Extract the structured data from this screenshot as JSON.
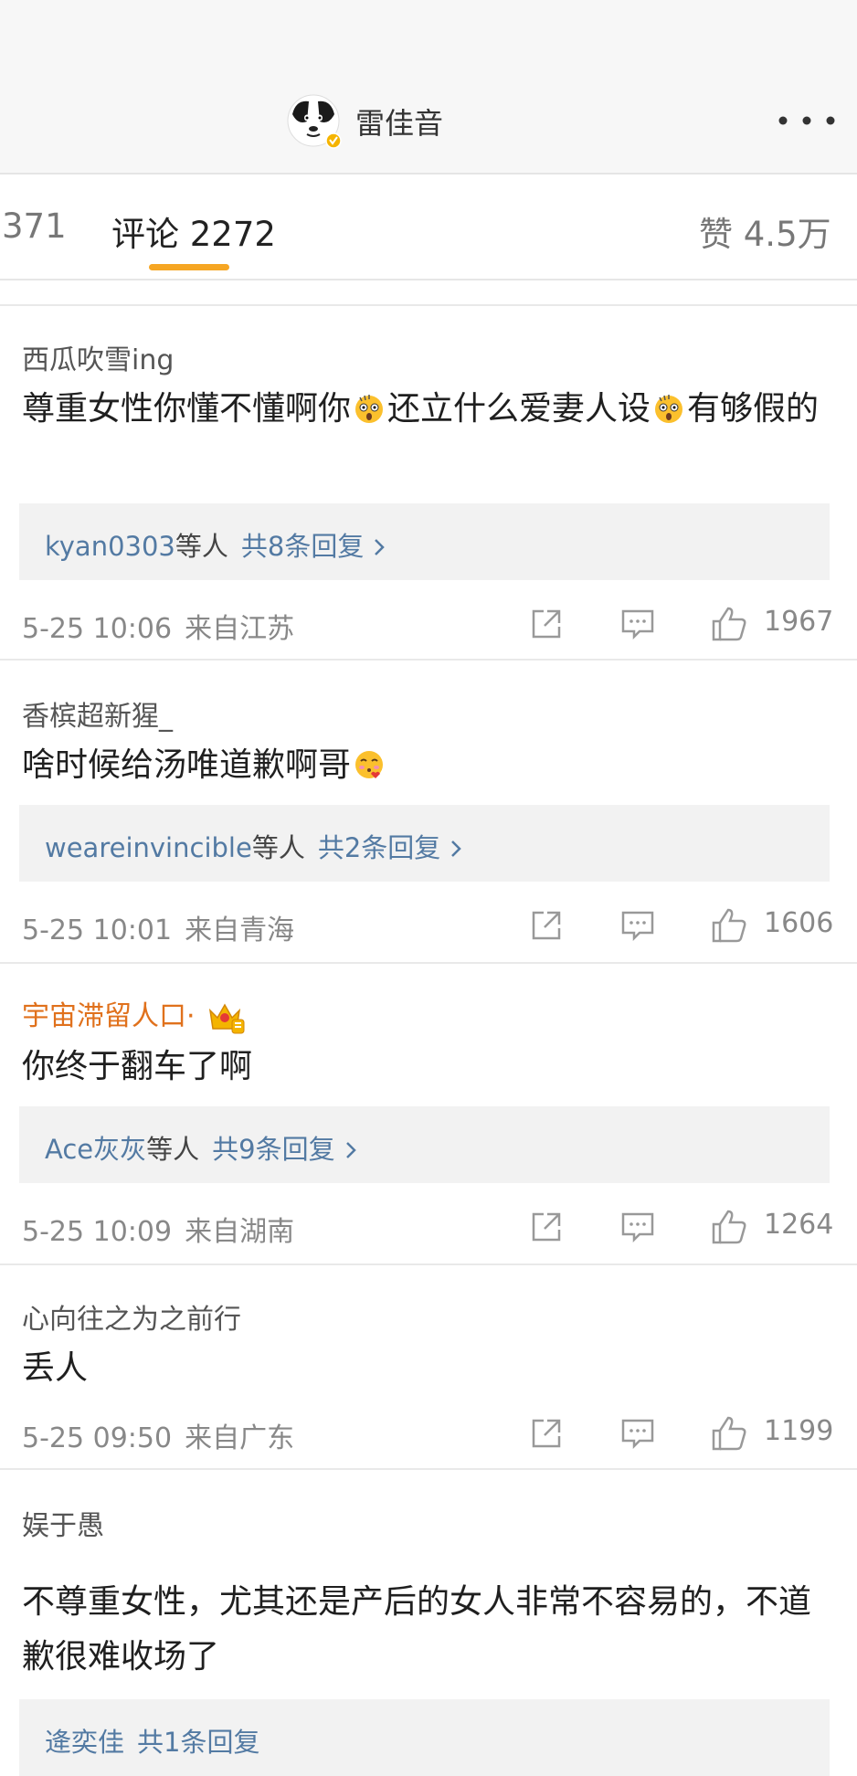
{
  "header": {
    "title": "雷佳音",
    "avatar_icon": "dog-avatar-icon",
    "verified_badge_icon": "verified-badge-icon",
    "more_icon": "more-dots-icon"
  },
  "tabs": {
    "reposts_partial": "371",
    "comments_label": "评论",
    "comments_count": "2272",
    "likes_label": "赞",
    "likes_count": "4.5万",
    "active_color": "#f6a623"
  },
  "comments": [
    {
      "user": "西瓜吹雪ing",
      "text_parts": [
        "尊重女性你懂不懂啊你",
        "还立什么爱妻人设",
        "有够假的"
      ],
      "reply_users": "kyan0303",
      "reply_suffix": "等人",
      "reply_total": "共8条回复",
      "time": "5-25 10:06",
      "location": "来自江苏",
      "likes": "1967"
    },
    {
      "user": "香槟超新猩_",
      "text_parts": [
        "啥时候给汤唯道歉啊哥"
      ],
      "reply_users": "weareinvincible",
      "reply_suffix": "等人",
      "reply_total": "共2条回复",
      "time": "5-25 10:01",
      "location": "来自青海",
      "likes": "1606"
    },
    {
      "user": "宇宙滞留人口·",
      "text_parts": [
        "你终于翻车了啊"
      ],
      "reply_users": "Ace灰灰",
      "reply_suffix": "等人",
      "reply_total": "共9条回复",
      "time": "5-25 10:09",
      "location": "来自湖南",
      "likes": "1264"
    },
    {
      "user": "心向往之为之前行",
      "text_parts": [
        "丢人"
      ],
      "time": "5-25 09:50",
      "location": "来自广东",
      "likes": "1199"
    },
    {
      "user": "娱于愚",
      "text_parts": [
        "不尊重女性，尤其还是产后的女人非常不容易的，不道歉很难收场了"
      ],
      "reply_users": "逄奕佳",
      "reply_total": "共1条回复"
    }
  ],
  "icons": {
    "share": "share-icon",
    "comment": "comment-icon",
    "like": "thumbs-up-icon",
    "shocked_emoji": "shocked-emoji-icon",
    "blush_emoji": "blush-heart-emoji-icon",
    "crown_badge": "crown-badge-icon"
  }
}
